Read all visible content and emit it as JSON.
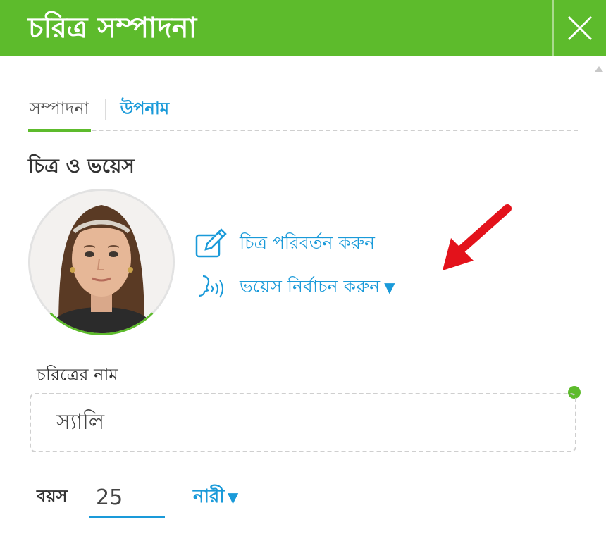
{
  "dialog": {
    "title": "চরিত্র সম্পাদনা",
    "close_icon": "close-icon"
  },
  "tabs": [
    {
      "label": "সম্পাদনা",
      "active": true
    },
    {
      "label": "উপনাম",
      "active": false
    }
  ],
  "image_voice": {
    "section_title": "চিত্র ও ভয়েস",
    "change_image_label": "চিত্র পরিবর্তন করুন",
    "change_image_icon": "edit-icon",
    "select_voice_label": "ভয়েস নির্বাচন করুন",
    "select_voice_icon": "voice-icon",
    "select_voice_caret": "▼"
  },
  "character": {
    "name_label": "চরিত্রের নাম",
    "name_value": "স্যালি",
    "age_label": "বয়স",
    "age_value": "25",
    "gender_value": "নারী",
    "gender_caret": "▼"
  },
  "colors": {
    "header_green": "#5dbb2c",
    "link_blue": "#1a9ad9",
    "annotation_red": "#e3121b"
  }
}
